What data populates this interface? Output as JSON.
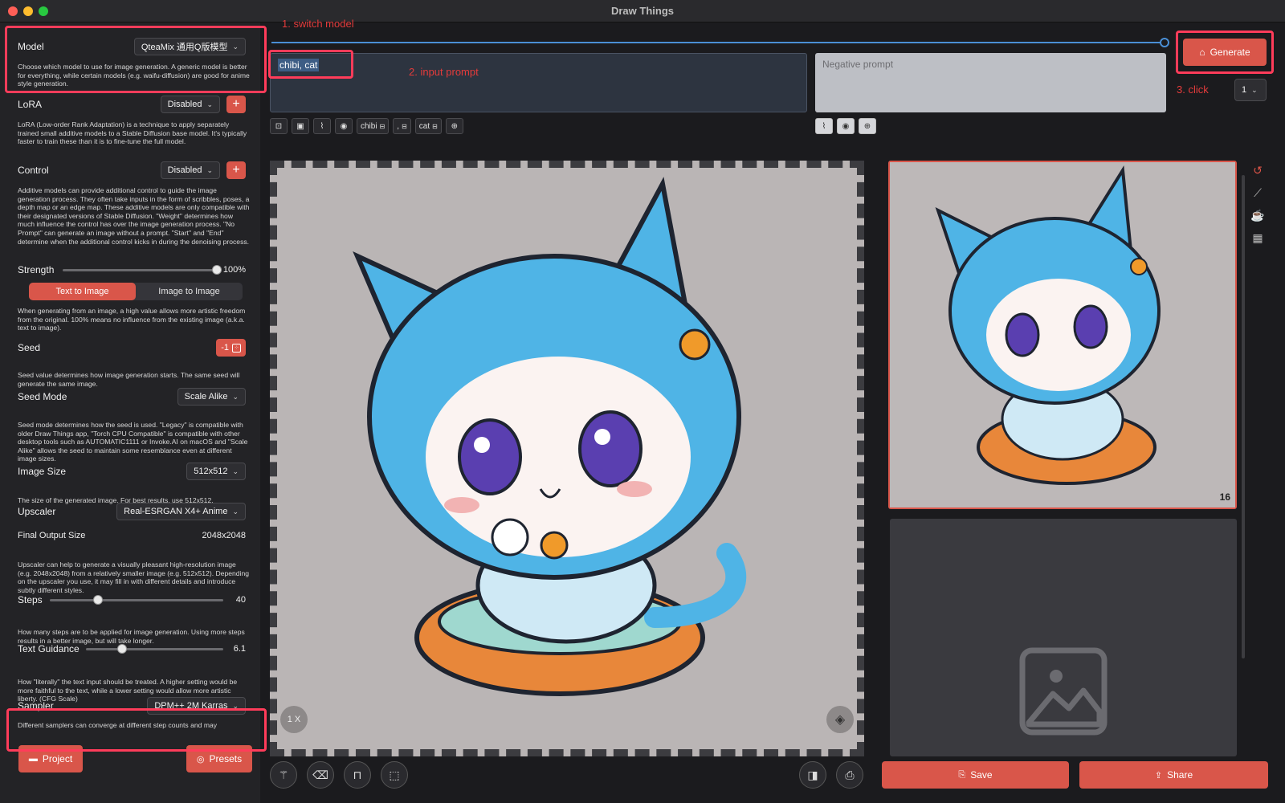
{
  "window": {
    "title": "Draw Things"
  },
  "sidebar": {
    "model": {
      "label": "Model",
      "value": "QteaMix 通用Q版模型",
      "desc": "Choose which model to use for image generation. A generic model is better for everything, while certain models (e.g. waifu-diffusion) are good for anime style generation."
    },
    "lora": {
      "label": "LoRA",
      "value": "Disabled",
      "desc": "LoRA (Low-order Rank Adaptation) is a technique to apply separately trained small additive models to a Stable Diffusion base model. It's typically faster to train these than it is to fine-tune the full model."
    },
    "control": {
      "label": "Control",
      "value": "Disabled",
      "desc": "Additive models can provide additional control to guide the image generation process. They often take inputs in the form of scribbles, poses, a depth map or an edge map. These additive models are only compatible with their designated versions of Stable Diffusion. \"Weight\" determines how much influence the control has over the image generation process. \"No Prompt\" can generate an image without a prompt. \"Start\" and \"End\" determine when the additional control kicks in during the denoising process."
    },
    "strength": {
      "label": "Strength",
      "value_text": "100%",
      "value": 1.0
    },
    "mode_tabs": [
      "Text to Image",
      "Image to Image"
    ],
    "mode_desc": "When generating from an image, a high value allows more artistic freedom from the original. 100% means no influence from the existing image (a.k.a. text to image).",
    "seed": {
      "label": "Seed",
      "value": "-1",
      "desc": "Seed value determines how image generation starts. The same seed will generate the same image."
    },
    "seed_mode": {
      "label": "Seed Mode",
      "value": "Scale Alike",
      "desc": "Seed mode determines how the seed is used. \"Legacy\" is compatible with older Draw Things app, \"Torch CPU Compatible\" is compatible with other desktop tools such as AUTOMATIC1111 or Invoke.AI on macOS and \"Scale Alike\" allows the seed to maintain some resemblance even at different image sizes."
    },
    "image_size": {
      "label": "Image Size",
      "value": "512x512",
      "desc": "The size of the generated image. For best results, use 512x512."
    },
    "upscaler": {
      "label": "Upscaler",
      "value": "Real-ESRGAN X4+ Anime"
    },
    "final_output": {
      "label": "Final Output Size",
      "value": "2048x2048",
      "desc": "Upscaler can help to generate a visually pleasant high-resolution image (e.g. 2048x2048) from a relatively smaller image (e.g. 512x512). Depending on the upscaler you use, it may fill in with different details and introduce subtly different styles."
    },
    "steps": {
      "label": "Steps",
      "value_text": "40",
      "value": 40,
      "max": 150,
      "desc": "How many steps are to be applied for image generation. Using more steps results in a better image, but will take longer."
    },
    "guidance": {
      "label": "Text Guidance",
      "value_text": "6.1",
      "value": 6.1,
      "max": 25,
      "desc": "How \"literally\" the text input should be treated. A higher setting would be more faithful to the text, while a lower setting would allow more artistic liberty. (CFG Scale)"
    },
    "sampler": {
      "label": "Sampler",
      "value": "DPM++ 2M Karras",
      "desc": "Different samplers can converge at different step counts and may"
    },
    "project_btn": "Project",
    "presets_btn": "Presets"
  },
  "annotations": {
    "a1": "1. switch model",
    "a2": "2. input prompt",
    "a3": "3. click"
  },
  "prompt": {
    "value": "chibi, cat",
    "negative_placeholder": "Negative prompt",
    "chips": [
      "chibi",
      ",",
      "cat"
    ]
  },
  "generate": {
    "label": "Generate",
    "count": "1"
  },
  "canvas": {
    "zoom": "1 X"
  },
  "history": {
    "badge": "16"
  },
  "bottom": {
    "save": "Save",
    "share": "Share"
  },
  "colors": {
    "accent": "#d9564a",
    "highlight": "#ff3c5a",
    "annotation": "#e43b3b"
  }
}
